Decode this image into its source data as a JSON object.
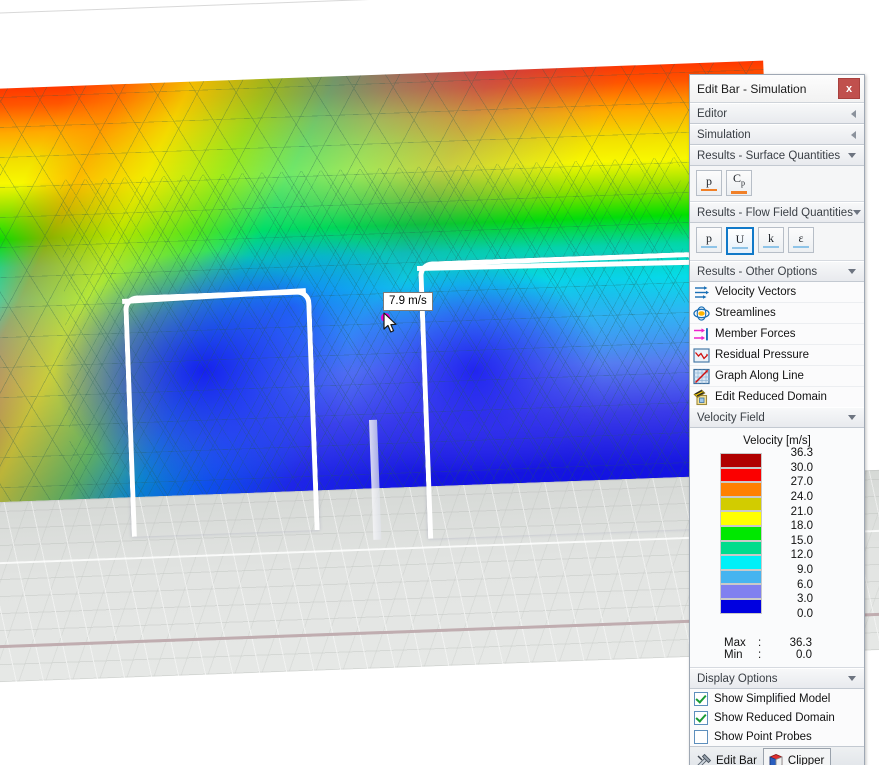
{
  "viewport": {
    "probe_tooltip": "7.9 m/s",
    "probe_color": "#ee00cc"
  },
  "panel": {
    "title": "Edit Bar - Simulation",
    "close_label": "x",
    "close_color": "#c0504d"
  },
  "sections": {
    "editor": {
      "label": "Editor",
      "state": "collapsed"
    },
    "simulation": {
      "label": "Simulation",
      "state": "collapsed"
    },
    "surface_quantities": {
      "label": "Results - Surface Quantities",
      "state": "expanded",
      "buttons": [
        {
          "name": "p-button",
          "glyph": "p",
          "sub": "",
          "selected": false,
          "underline": "#f08028"
        },
        {
          "name": "cp-button",
          "glyph": "C",
          "sub": "p",
          "selected": false,
          "underline": "#f08028"
        }
      ]
    },
    "flow_field_quantities": {
      "label": "Results - Flow Field Quantities",
      "state": "expanded",
      "buttons": [
        {
          "name": "p-button",
          "glyph": "p",
          "sub": "",
          "selected": false,
          "underline": "#8fc4e8"
        },
        {
          "name": "u-button",
          "glyph": "U",
          "sub": "",
          "selected": true,
          "underline": "#8fc4e8"
        },
        {
          "name": "k-button",
          "glyph": "k",
          "sub": "",
          "selected": false,
          "underline": "#8fc4e8"
        },
        {
          "name": "epsilon-button",
          "glyph": "ε",
          "sub": "",
          "selected": false,
          "underline": "#8fc4e8"
        }
      ]
    },
    "other_options": {
      "label": "Results - Other Options",
      "state": "expanded",
      "items": [
        {
          "icon": "velocity-vectors-icon",
          "label": "Velocity Vectors"
        },
        {
          "icon": "streamlines-icon",
          "label": "Streamlines"
        },
        {
          "icon": "member-forces-icon",
          "label": "Member Forces"
        },
        {
          "icon": "residual-pressure-icon",
          "label": "Residual Pressure"
        },
        {
          "icon": "graph-along-line-icon",
          "label": "Graph Along Line"
        },
        {
          "icon": "edit-reduced-domain-icon",
          "label": "Edit Reduced Domain"
        }
      ]
    },
    "velocity_field": {
      "label": "Velocity Field",
      "state": "expanded"
    },
    "display_options": {
      "label": "Display Options",
      "state": "expanded",
      "checkboxes": [
        {
          "label": "Show Simplified Model",
          "checked": true
        },
        {
          "label": "Show Reduced Domain",
          "checked": true
        },
        {
          "label": "Show Point Probes",
          "checked": false
        }
      ]
    }
  },
  "legend": {
    "title": "Velocity [m/s]",
    "swatches": [
      {
        "color": "#b00000",
        "value": "36.3"
      },
      {
        "color": "#fb0000",
        "value": "30.0"
      },
      {
        "color": "#ff8000",
        "value": "27.0"
      },
      {
        "color": "#d2cc00",
        "value": "24.0"
      },
      {
        "color": "#ffff00",
        "value": "21.0"
      },
      {
        "color": "#00e800",
        "value": "18.0"
      },
      {
        "color": "#00dc8c",
        "value": "15.0"
      },
      {
        "color": "#00f0f8",
        "value": "12.0"
      },
      {
        "color": "#46b4f0",
        "value": "9.0"
      },
      {
        "color": "#8080f0",
        "value": "6.0"
      },
      {
        "color": "#0000e0",
        "value": "3.0"
      }
    ],
    "last_value": "0.0",
    "max_key": "Max",
    "min_key": "Min",
    "colon": ":",
    "max_value": "36.3",
    "min_value": "0.0"
  },
  "tabs": [
    {
      "label": "Edit Bar",
      "icon": "tools-icon",
      "active": false
    },
    {
      "label": "Clipper",
      "icon": "clipper-icon",
      "active": true
    }
  ],
  "chart_data": {
    "type": "heatmap",
    "title": "Velocity [m/s]",
    "colorbar_levels": [
      36.3,
      30.0,
      27.0,
      24.0,
      21.0,
      18.0,
      15.0,
      12.0,
      9.0,
      6.0,
      3.0,
      0.0
    ],
    "colorbar_colors": [
      "#b00000",
      "#fb0000",
      "#ff8000",
      "#d2cc00",
      "#ffff00",
      "#00e800",
      "#00dc8c",
      "#00f0f8",
      "#46b4f0",
      "#8080f0",
      "#0000e0"
    ],
    "max": 36.3,
    "min": 0.0,
    "probe_value": 7.9,
    "units": "m/s"
  }
}
